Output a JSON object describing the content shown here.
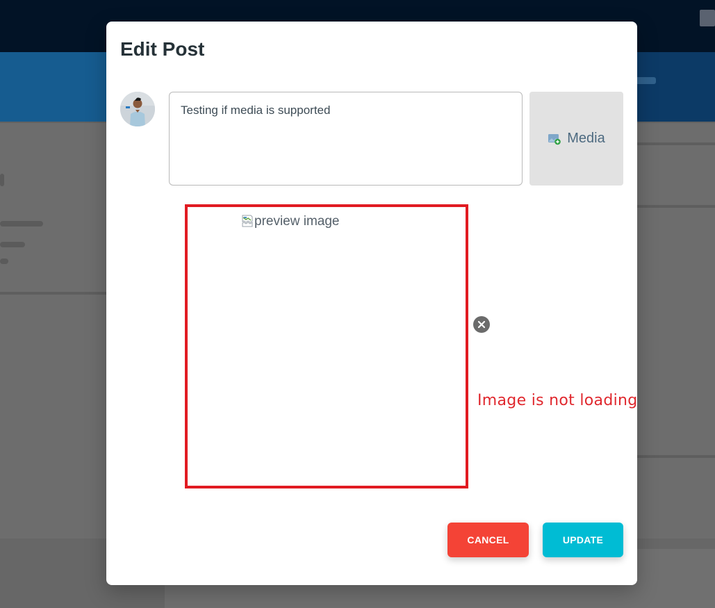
{
  "modal": {
    "title": "Edit Post",
    "post_text": "Testing if media is supported",
    "media_label": "Media",
    "preview_alt": "preview image",
    "annotation": "Image is not loading",
    "cancel_label": "CANCEL",
    "update_label": "UPDATE"
  },
  "icons": {
    "avatar": "user-avatar",
    "media": "image-add-icon",
    "broken": "broken-image-icon",
    "remove": "close-icon"
  },
  "colors": {
    "cancel": "#f44336",
    "update": "#00bcd4",
    "annotation": "#e0282e",
    "highlight_border": "#e11b22"
  }
}
